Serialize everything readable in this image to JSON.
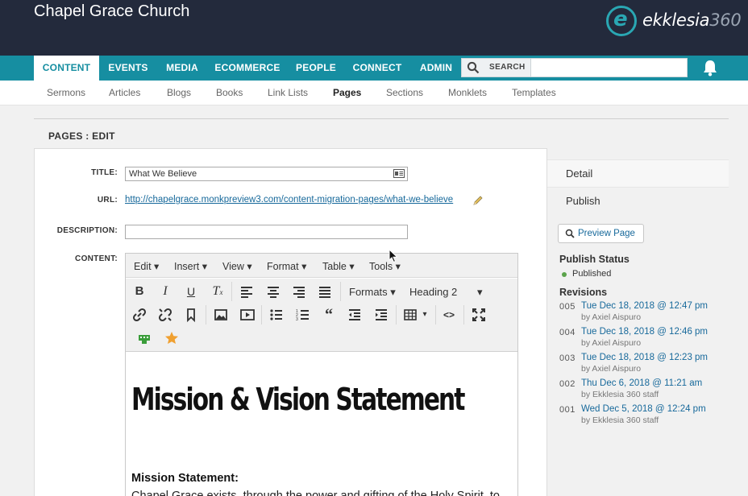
{
  "site": {
    "title": "Chapel Grace Church"
  },
  "brand": {
    "name": "ekklesia",
    "num": "360",
    "color": "#2aa7b3"
  },
  "mainnav": {
    "tabs": [
      {
        "label": "CONTENT",
        "active": true
      },
      {
        "label": "EVENTS"
      },
      {
        "label": "MEDIA"
      },
      {
        "label": "ECOMMERCE"
      },
      {
        "label": "PEOPLE"
      },
      {
        "label": "CONNECT"
      },
      {
        "label": "ADMIN"
      }
    ],
    "search_label": "SEARCH",
    "bg": "#168ea1"
  },
  "subnav": {
    "items": [
      "Sermons",
      "Articles",
      "Blogs",
      "Books",
      "Link Lists",
      "Pages",
      "Sections",
      "Monklets",
      "Templates"
    ],
    "active": "Pages"
  },
  "page": {
    "heading": "PAGES : EDIT"
  },
  "form": {
    "title_label": "TITLE:",
    "title_value": "What We Believe",
    "url_label": "URL:",
    "url_value": "http://chapelgrace.monkpreview3.com/content-migration-pages/what-we-believe",
    "description_label": "DESCRIPTION:",
    "description_value": "",
    "content_label": "CONTENT:"
  },
  "editor": {
    "menus": [
      "Edit",
      "Insert",
      "View",
      "Format",
      "Table",
      "Tools"
    ],
    "formats_label": "Formats",
    "heading_label": "Heading 2",
    "content": {
      "h1": "Mission & Vision Statement",
      "mission_title": "Mission Statement:",
      "mission_text": "Chapel Grace exists, through the power and gifting of the Holy Spirit, to"
    }
  },
  "side": {
    "tabs": [
      "Detail",
      "Publish"
    ],
    "preview_label": "Preview Page",
    "publish_status_heading": "Publish Status",
    "publish_status": "Published",
    "revisions_heading": "Revisions",
    "revisions": [
      {
        "num": "005",
        "date": "Tue Dec 18, 2018 @ 12:47 pm",
        "by": "by Axiel Aispuro"
      },
      {
        "num": "004",
        "date": "Tue Dec 18, 2018 @ 12:46 pm",
        "by": "by Axiel Aispuro"
      },
      {
        "num": "003",
        "date": "Tue Dec 18, 2018 @ 12:23 pm",
        "by": "by Axiel Aispuro"
      },
      {
        "num": "002",
        "date": "Thu Dec 6, 2018 @ 11:21 am",
        "by": "by Ekklesia 360 staff"
      },
      {
        "num": "001",
        "date": "Wed Dec 5, 2018 @ 12:24 pm",
        "by": "by Ekklesia 360 staff"
      }
    ]
  }
}
